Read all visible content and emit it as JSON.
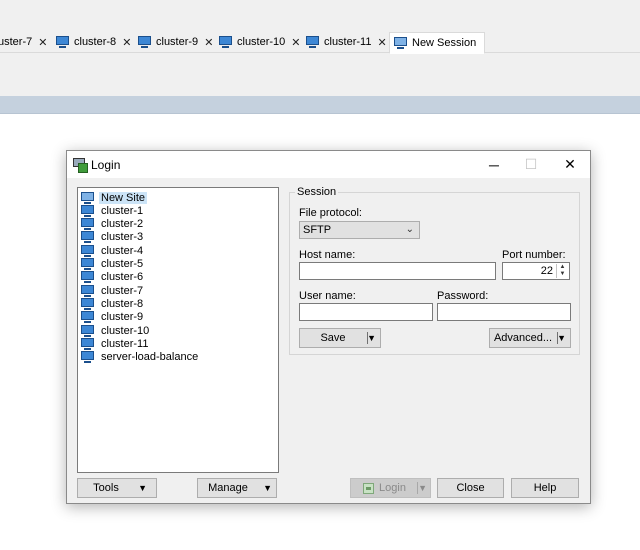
{
  "tabs": [
    {
      "label": "uster-7"
    },
    {
      "label": "cluster-8"
    },
    {
      "label": "cluster-9"
    },
    {
      "label": "cluster-10"
    },
    {
      "label": "cluster-11"
    }
  ],
  "active_tab": {
    "label": "New Session"
  },
  "tab_close_glyph": "✕",
  "dialog": {
    "title": "Login",
    "minimize": "─",
    "maximize": "☐",
    "close": "✕",
    "sites": [
      {
        "label": "New Site",
        "icon": "new-site-icon"
      },
      {
        "label": "cluster-1",
        "icon": "monitor-icon"
      },
      {
        "label": "cluster-2",
        "icon": "monitor-icon"
      },
      {
        "label": "cluster-3",
        "icon": "monitor-icon"
      },
      {
        "label": "cluster-4",
        "icon": "monitor-icon"
      },
      {
        "label": "cluster-5",
        "icon": "monitor-icon"
      },
      {
        "label": "cluster-6",
        "icon": "monitor-icon"
      },
      {
        "label": "cluster-7",
        "icon": "monitor-icon"
      },
      {
        "label": "cluster-8",
        "icon": "monitor-icon"
      },
      {
        "label": "cluster-9",
        "icon": "monitor-icon"
      },
      {
        "label": "cluster-10",
        "icon": "monitor-icon"
      },
      {
        "label": "cluster-11",
        "icon": "monitor-icon"
      },
      {
        "label": "server-load-balance",
        "icon": "monitor-icon"
      }
    ],
    "session": {
      "group_title": "Session",
      "file_protocol_label": "File protocol:",
      "file_protocol_value": "SFTP",
      "host_name_label": "Host name:",
      "host_name_value": "",
      "port_label": "Port number:",
      "port_value": "22",
      "user_name_label": "User name:",
      "user_name_value": "",
      "password_label": "Password:",
      "password_value": "",
      "save_label": "Save",
      "advanced_label": "Advanced..."
    },
    "buttons": {
      "tools": "Tools",
      "manage": "Manage",
      "login": "Login",
      "close": "Close",
      "help": "Help"
    },
    "dropdown_glyph": "▼",
    "spin_up": "▲",
    "spin_down": "▼"
  }
}
